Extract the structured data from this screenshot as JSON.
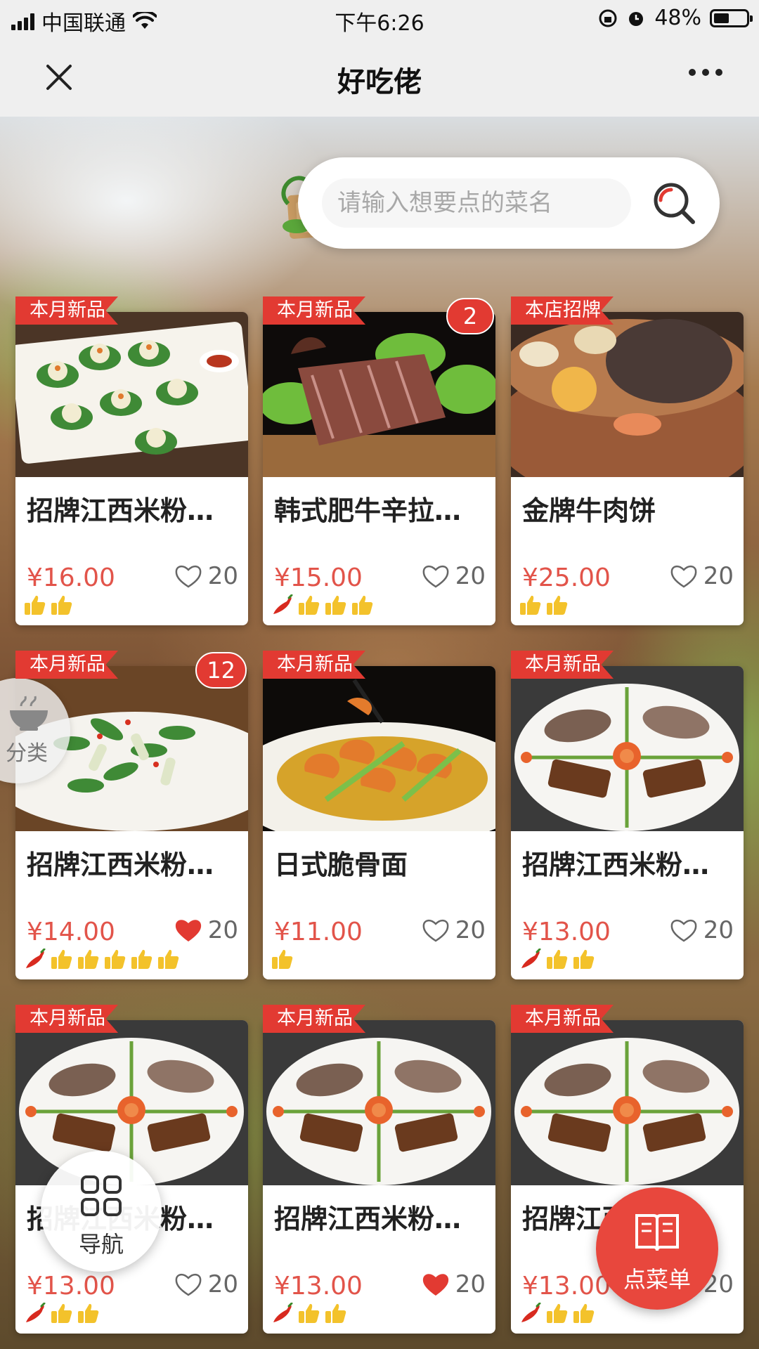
{
  "status_bar": {
    "carrier": "中国联通",
    "time": "下午6:26",
    "battery_pct": "48%",
    "battery_level": 0.48
  },
  "navbar": {
    "title": "好吃佬"
  },
  "search": {
    "placeholder": "请输入想要点的菜名"
  },
  "items": [
    {
      "tag": "本月新品",
      "badge": "",
      "title": "招牌江西米粉…",
      "price": "¥16.00",
      "likes": "20",
      "liked": false,
      "spicy": false,
      "thumbs": 2,
      "photo": "dumplings"
    },
    {
      "tag": "本月新品",
      "badge": "2",
      "title": "韩式肥牛辛拉…",
      "price": "¥15.00",
      "likes": "20",
      "liked": false,
      "spicy": true,
      "thumbs": 3,
      "photo": "duck"
    },
    {
      "tag": "本店招牌",
      "badge": "",
      "title": "金牌牛肉饼",
      "price": "¥25.00",
      "likes": "20",
      "liked": false,
      "spicy": false,
      "thumbs": 2,
      "photo": "clay-pot"
    },
    {
      "tag": "本月新品",
      "badge": "12",
      "title": "招牌江西米粉…",
      "price": "¥14.00",
      "likes": "20",
      "liked": true,
      "spicy": true,
      "thumbs": 5,
      "photo": "greens"
    },
    {
      "tag": "本月新品",
      "badge": "",
      "title": "日式脆骨面",
      "price": "¥11.00",
      "likes": "20",
      "liked": false,
      "spicy": false,
      "thumbs": 1,
      "photo": "shrimp"
    },
    {
      "tag": "本月新品",
      "badge": "",
      "title": "招牌江西米粉…",
      "price": "¥13.00",
      "likes": "20",
      "liked": false,
      "spicy": true,
      "thumbs": 2,
      "photo": "platter"
    },
    {
      "tag": "本月新品",
      "badge": "",
      "title": "招牌江西米粉…",
      "price": "¥13.00",
      "likes": "20",
      "liked": false,
      "spicy": true,
      "thumbs": 2,
      "photo": "platter"
    },
    {
      "tag": "本月新品",
      "badge": "",
      "title": "招牌江西米粉…",
      "price": "¥13.00",
      "likes": "20",
      "liked": true,
      "spicy": true,
      "thumbs": 2,
      "photo": "platter"
    },
    {
      "tag": "本月新品",
      "badge": "",
      "title": "招牌江西米粉…",
      "price": "¥13.00",
      "likes": "20",
      "liked": false,
      "spicy": true,
      "thumbs": 2,
      "photo": "platter"
    }
  ],
  "floating": {
    "category_label": "分类",
    "nav_label": "导航",
    "order_label": "点菜单"
  },
  "colors": {
    "accent": "#e23a32",
    "price": "#e2544a",
    "liked": "#e23a32"
  }
}
